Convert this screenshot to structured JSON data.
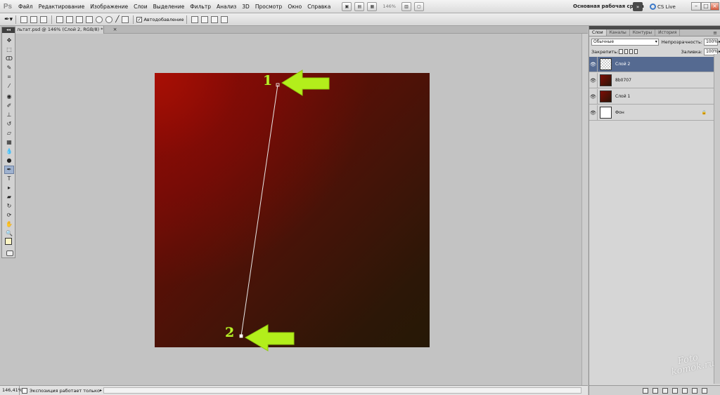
{
  "app": {
    "logo": "Ps"
  },
  "menu": [
    "Файл",
    "Редактирование",
    "Изображение",
    "Слои",
    "Выделение",
    "Фильтр",
    "Анализ",
    "3D",
    "Просмотр",
    "Окно",
    "Справка"
  ],
  "menubar": {
    "zoom": "146%",
    "workspace": "Основная рабочая среда",
    "more": "»",
    "cslive": "CS Live",
    "window_buttons": [
      "–",
      "□",
      "×"
    ]
  },
  "options": {
    "auto_add_check": "✓",
    "auto_add_label": "Автодобавление"
  },
  "document": {
    "tab_title": "льтат.psd @ 146% (Слой 2, RGB/8) *",
    "close": "×"
  },
  "toolbox": {
    "grip": "◂◂",
    "tools": [
      {
        "name": "move-tool",
        "glyph": "✥"
      },
      {
        "name": "marquee-tool",
        "glyph": "⬚"
      },
      {
        "name": "lasso-tool",
        "glyph": "ↀ"
      },
      {
        "name": "quick-select-tool",
        "glyph": "✎"
      },
      {
        "name": "crop-tool",
        "glyph": "⌗"
      },
      {
        "name": "eyedropper-tool",
        "glyph": "⁄"
      },
      {
        "name": "healing-tool",
        "glyph": "◉"
      },
      {
        "name": "brush-tool",
        "glyph": "✐"
      },
      {
        "name": "stamp-tool",
        "glyph": "⊥"
      },
      {
        "name": "history-brush-tool",
        "glyph": "↺"
      },
      {
        "name": "eraser-tool",
        "glyph": "▱"
      },
      {
        "name": "gradient-tool",
        "glyph": "▦"
      },
      {
        "name": "blur-tool",
        "glyph": "💧"
      },
      {
        "name": "dodge-tool",
        "glyph": "●"
      },
      {
        "name": "pen-tool",
        "glyph": "✒"
      },
      {
        "name": "type-tool",
        "glyph": "T"
      },
      {
        "name": "path-select-tool",
        "glyph": "▸"
      },
      {
        "name": "shape-tool",
        "glyph": "▰"
      },
      {
        "name": "3d-rotate-tool",
        "glyph": "↻"
      },
      {
        "name": "3d-orbit-tool",
        "glyph": "⟳"
      },
      {
        "name": "hand-tool",
        "glyph": "✋"
      },
      {
        "name": "zoom-tool",
        "glyph": "🔍"
      }
    ]
  },
  "annotations": {
    "step1": "1",
    "step2": "2"
  },
  "colors": {
    "arrow": "#b3ee1b",
    "selected_layer": "#556a91",
    "foreground": "#fbf4c4",
    "background": "#111111"
  },
  "status": {
    "zoom": "146,41%",
    "text": "Экспозиция работает только в ...",
    "arrow": "▸"
  },
  "panel": {
    "tabs": [
      "Слои",
      "Каналы",
      "Контуры",
      "История"
    ],
    "menu": "≡",
    "blend_mode": "Обычные",
    "opacity_label": "Непрозрачность:",
    "opacity_value": "100%",
    "lock_label": "Закрепить:",
    "fill_label": "Заливка:",
    "fill_value": "100%",
    "layers": [
      {
        "name": "Слой 2",
        "thumb": "checker",
        "selected": true,
        "locked": false
      },
      {
        "name": "8b0707",
        "thumb": "red",
        "selected": false,
        "locked": false
      },
      {
        "name": "Слой 1",
        "thumb": "red",
        "selected": false,
        "locked": false
      },
      {
        "name": "Фон",
        "thumb": "white",
        "selected": false,
        "locked": true
      }
    ],
    "eye": "👁",
    "lock_glyph": "🔒"
  },
  "watermark": {
    "line1": "Foto",
    "line2": "komok.ru"
  }
}
